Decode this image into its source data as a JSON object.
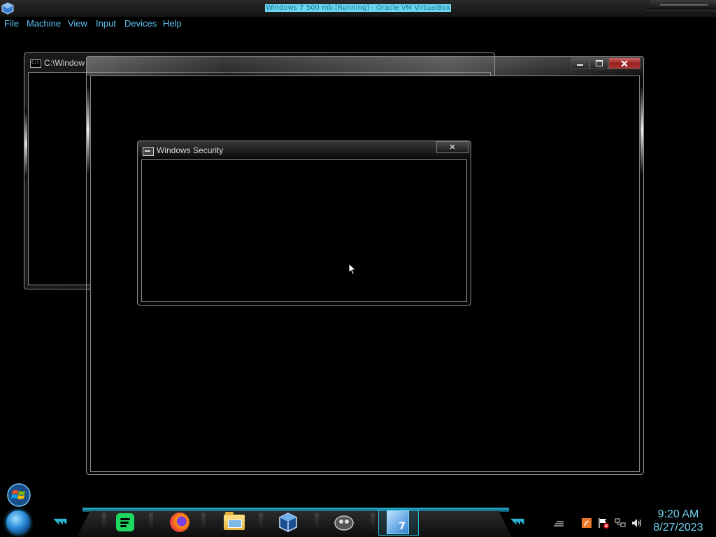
{
  "host": {
    "title": "Windows 7 500 mb [Running] - Oracle VM VirtualBox",
    "menu": [
      "File",
      "Machine",
      "View",
      "Input",
      "Devices",
      "Help"
    ]
  },
  "windows": {
    "cmd": {
      "title": "C:\\Window"
    },
    "main": {
      "title": ""
    },
    "security_dialog": {
      "title": "Windows Security",
      "close_glyph": "✕"
    }
  },
  "taskbar": {
    "pinned": [
      "spotify-icon",
      "firefox-icon",
      "file-explorer-icon",
      "virtualbox-icon",
      "media-player-icon",
      "windows7-manager-icon"
    ],
    "tray_icons": [
      "show-hidden-icon",
      "java-update-icon",
      "action-center-flag-icon",
      "network-icon",
      "volume-icon"
    ],
    "clock": {
      "time": "9:20 AM",
      "date": "8/27/2023"
    }
  },
  "colors": {
    "accent": "#2ab7d6",
    "menu_text": "#5ec3f0",
    "clock_text": "#6fd3ef",
    "close_red": "#a33333"
  }
}
